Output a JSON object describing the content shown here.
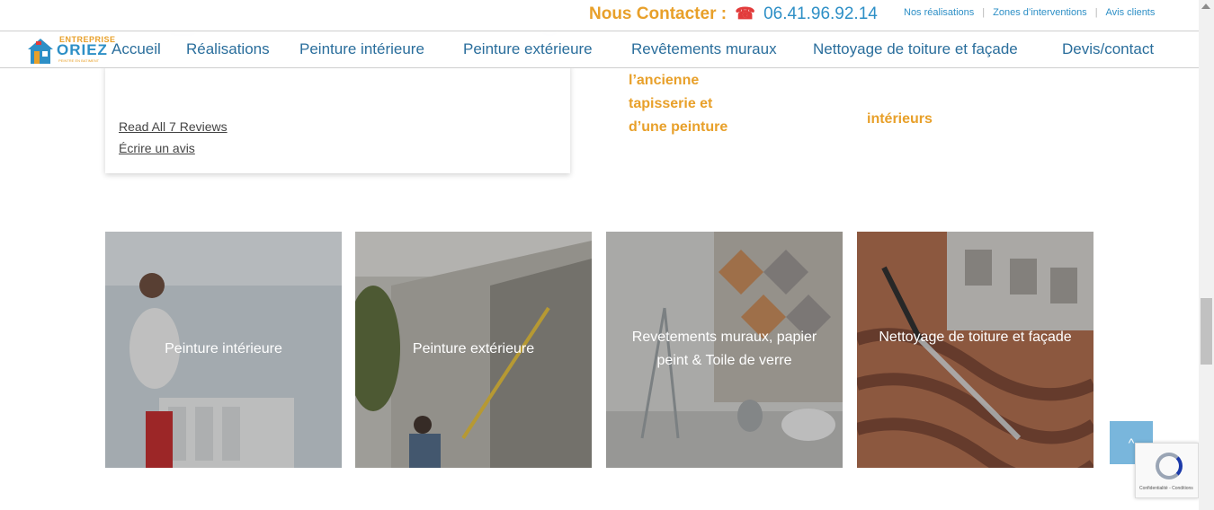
{
  "header": {
    "contact_label": "Nous Contacter :",
    "phone_icon": "phone-icon",
    "phone": "06.41.96.92.14",
    "top_links": [
      "Nos réalisations",
      "Zones d’interventions",
      "Avis clients"
    ]
  },
  "logo": {
    "line1": "ENTREPRISE",
    "line2": "ORIEZ",
    "line3": "PEINTRE EN BATIMENT"
  },
  "nav": {
    "items": [
      "Accueil",
      "Réalisations",
      "Peinture intérieure",
      "Peinture extérieure",
      "Revêtements muraux",
      "Nettoyage de toiture et façade",
      "Devis/contact"
    ]
  },
  "reviews": {
    "read_all": "Read All 7 Reviews",
    "write": "Écrire un avis"
  },
  "features": {
    "col1": [
      "l’ancienne",
      "tapisserie et",
      "d’une peinture"
    ],
    "col2": "intérieurs"
  },
  "services": [
    {
      "label": "Peinture intérieure"
    },
    {
      "label": "Peinture extérieure"
    },
    {
      "label": "Revetements muraux, papier peint & Toile de verre"
    },
    {
      "label": "Nettoyage de toiture et façade"
    }
  ],
  "back_to_top": "^",
  "recaptcha": "Confidentialité - Conditions",
  "colors": {
    "accent_orange": "#e8a02a",
    "brand_blue": "#2d8fc6",
    "nav_blue": "#2a6e9c"
  }
}
